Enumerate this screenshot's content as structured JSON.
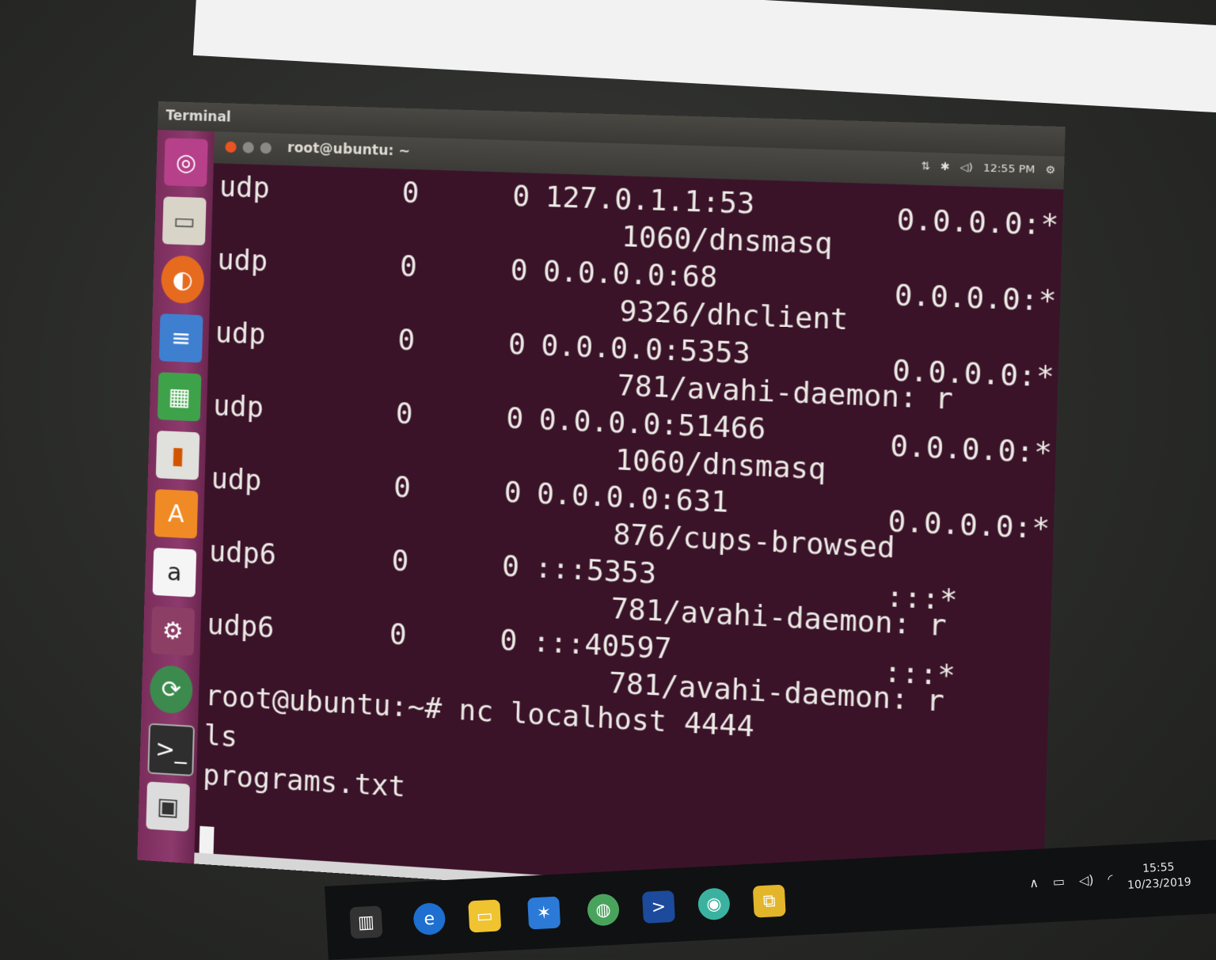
{
  "vm_window": {
    "title": "Terminal"
  },
  "ubuntu_topbar": {
    "window_title": "root@ubuntu: ~",
    "clock": "12:55 PM"
  },
  "launcher": {
    "items": [
      "ubuntu-dash",
      "files",
      "firefox",
      "libreoffice-writer",
      "libreoffice-calc",
      "libreoffice-impress",
      "ubuntu-software",
      "amazon",
      "system-settings",
      "software-updater",
      "terminal",
      "floppy"
    ],
    "amazon_glyph": "a",
    "software_glyph": "A"
  },
  "terminal": {
    "netstat_rows": [
      {
        "proto": "udp",
        "recv": "0",
        "send": "0",
        "local": "127.0.1.1:53",
        "foreign": "0.0.0.0:*",
        "program": "1060/dnsmasq"
      },
      {
        "proto": "udp",
        "recv": "0",
        "send": "0",
        "local": "0.0.0.0:68",
        "foreign": "0.0.0.0:*",
        "program": "9326/dhclient"
      },
      {
        "proto": "udp",
        "recv": "0",
        "send": "0",
        "local": "0.0.0.0:5353",
        "foreign": "0.0.0.0:*",
        "program": "781/avahi-daemon: r"
      },
      {
        "proto": "udp",
        "recv": "0",
        "send": "0",
        "local": "0.0.0.0:51466",
        "foreign": "0.0.0.0:*",
        "program": "1060/dnsmasq"
      },
      {
        "proto": "udp",
        "recv": "0",
        "send": "0",
        "local": "0.0.0.0:631",
        "foreign": "0.0.0.0:*",
        "program": "876/cups-browsed"
      },
      {
        "proto": "udp6",
        "recv": "0",
        "send": "0",
        "local": ":::5353",
        "foreign": ":::*",
        "program": "781/avahi-daemon: r"
      },
      {
        "proto": "udp6",
        "recv": "0",
        "send": "0",
        "local": ":::40597",
        "foreign": ":::*",
        "program": "781/avahi-daemon: r"
      }
    ],
    "prompt_line": "root@ubuntu:~# nc localhost 4444",
    "output_lines": [
      "ls",
      "programs.txt"
    ]
  },
  "windows_tray": {
    "time": "15:55",
    "date": "10/23/2019"
  },
  "colors": {
    "terminal_bg": "#3b1329",
    "launcher": "#8d3a6d",
    "accent_orange": "#e95420"
  }
}
